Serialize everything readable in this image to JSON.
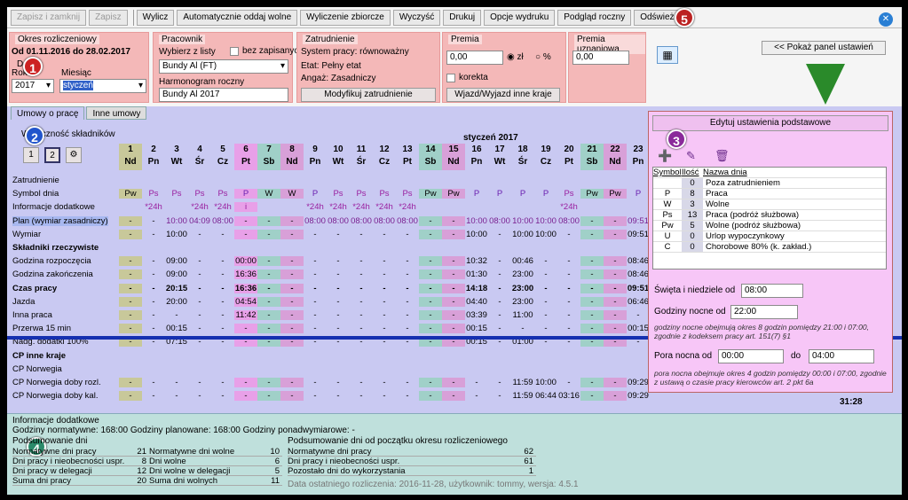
{
  "toolbar": {
    "save_close": "Zapisz i zamknij",
    "save": "Zapisz",
    "calc": "Wylicz",
    "auto": "Automatycznie oddaj wolne",
    "calc_all": "Wyliczenie zbiorcze",
    "clear": "Wyczyść",
    "print": "Drukuj",
    "print_opts": "Opcje wydruku",
    "preview": "Podgląd roczny",
    "refresh": "Odśwież"
  },
  "badges": [
    "1",
    "2",
    "3",
    "4",
    "5"
  ],
  "period": {
    "title": "Okres rozliczeniowy",
    "range": "Od  01.11.2016  do  28.02.2017",
    "data_label": "Da",
    "year_label": "Rok",
    "year": "2017",
    "month_label": "Miesiąc",
    "month": "styczeń"
  },
  "employee": {
    "title": "Pracownik",
    "choose_label": "Wybierz z listy",
    "unsaved_label": "bez zapisanych",
    "name": "Bundy Al (FT)",
    "harm_label": "Harmonogram roczny",
    "harm": "Bundy Al 2017"
  },
  "employment": {
    "title": "Zatrudnienie",
    "system": "System pracy: równoważny",
    "etat": "Etat: Pełny etat",
    "angaz": "Angaż: Zasadniczy",
    "modify": "Modyfikuj zatrudnienie"
  },
  "premia": {
    "title": "Premia",
    "value": "0,00",
    "pln": "zł",
    "pct": "%",
    "korekta": "korekta",
    "trip": "Wjazd/Wyjazd inne kraje"
  },
  "premia_uzn": {
    "title": "Premia uznaniowa",
    "value": "0,00"
  },
  "show_panel": "<< Pokaż panel ustawień",
  "tabs": [
    "Umowy o pracę",
    "Inne umowy"
  ],
  "grid": {
    "month_title": "styczeń 2017",
    "view_label": "Widoczność składników",
    "view_btns": [
      "1",
      "2"
    ],
    "days": [
      {
        "n": "1",
        "w": "Nd",
        "c": "#c8c89a"
      },
      {
        "n": "2",
        "w": "Pn",
        "c": ""
      },
      {
        "n": "3",
        "w": "Wt",
        "c": ""
      },
      {
        "n": "4",
        "w": "Śr",
        "c": ""
      },
      {
        "n": "5",
        "w": "Cz",
        "c": ""
      },
      {
        "n": "6",
        "w": "Pt",
        "c": "#e8a0e8"
      },
      {
        "n": "7",
        "w": "Sb",
        "c": "#a0d0c8"
      },
      {
        "n": "8",
        "w": "Nd",
        "c": "#d8a0d8"
      },
      {
        "n": "9",
        "w": "Pn",
        "c": ""
      },
      {
        "n": "10",
        "w": "Wt",
        "c": ""
      },
      {
        "n": "11",
        "w": "Śr",
        "c": ""
      },
      {
        "n": "12",
        "w": "Cz",
        "c": ""
      },
      {
        "n": "13",
        "w": "Pt",
        "c": ""
      },
      {
        "n": "14",
        "w": "Sb",
        "c": "#a0d0c8"
      },
      {
        "n": "15",
        "w": "Nd",
        "c": "#d8a0d8"
      },
      {
        "n": "16",
        "w": "Pn",
        "c": ""
      },
      {
        "n": "17",
        "w": "Wt",
        "c": ""
      },
      {
        "n": "18",
        "w": "Śr",
        "c": ""
      },
      {
        "n": "19",
        "w": "Cz",
        "c": ""
      },
      {
        "n": "20",
        "w": "Pt",
        "c": ""
      },
      {
        "n": "21",
        "w": "Sb",
        "c": "#a0d0c8"
      },
      {
        "n": "22",
        "w": "Nd",
        "c": "#d8a0d8"
      },
      {
        "n": "23",
        "w": "Pn",
        "c": ""
      }
    ],
    "rows": [
      {
        "label": "Zatrudnienie",
        "bold": false,
        "cells": [
          "",
          "",
          "",
          "",
          "",
          "",
          "",
          "",
          "",
          "",
          "",
          "",
          "",
          "",
          "",
          "",
          "",
          "",
          "",
          "",
          "",
          "",
          ""
        ]
      },
      {
        "label": "Symbol dnia",
        "bold": false,
        "cells": [
          "Pw",
          "Ps",
          "Ps",
          "Ps",
          "Ps",
          "P",
          "W",
          "W",
          "P",
          "Ps",
          "Ps",
          "Ps",
          "Ps",
          "Pw",
          "Pw",
          "P",
          "P",
          "P",
          "P",
          "Ps",
          "Pw",
          "Pw",
          "P"
        ]
      },
      {
        "label": "Informacje dodatkowe",
        "bold": false,
        "cells": [
          "",
          "*24h",
          "",
          "*24h",
          "*24h",
          "i",
          "",
          "",
          "*24h",
          "*24h",
          "*24h",
          "*24h",
          "*24h",
          "",
          "",
          "",
          "",
          "",
          "",
          "*24h",
          "",
          "",
          ""
        ]
      },
      {
        "label": "Plan (wymiar zasadniczy)",
        "bold": false,
        "cells": [
          "-",
          "-",
          "10:00",
          "04:09",
          "08:00",
          "-",
          "-",
          "-",
          "08:00",
          "08:00",
          "08:00",
          "08:00",
          "08:00",
          "-",
          "-",
          "10:00",
          "08:00",
          "10:00",
          "10:00",
          "08:00",
          "-",
          "-",
          "09:51"
        ]
      },
      {
        "label": "Wymiar",
        "bold": false,
        "cells": [
          "-",
          "-",
          "10:00",
          "-",
          "-",
          "-",
          "-",
          "-",
          "-",
          "-",
          "-",
          "-",
          "-",
          "-",
          "-",
          "10:00",
          "-",
          "10:00",
          "10:00",
          "-",
          "-",
          "-",
          "09:51"
        ]
      },
      {
        "label": "Składniki rzeczywiste",
        "bold": true,
        "cells": [
          "",
          "",
          "",
          "",
          "",
          "",
          "",
          "",
          "",
          "",
          "",
          "",
          "",
          "",
          "",
          "",
          "",
          "",
          "",
          "",
          "",
          "",
          ""
        ]
      },
      {
        "label": "Godzina rozpoczęcia",
        "bold": false,
        "cells": [
          "-",
          "-",
          "09:00",
          "-",
          "-",
          "00:00",
          "-",
          "-",
          "-",
          "-",
          "-",
          "-",
          "-",
          "-",
          "-",
          "10:32",
          "-",
          "00:46",
          "-",
          "-",
          "-",
          "-",
          "08:46"
        ]
      },
      {
        "label": "Godzina zakończenia",
        "bold": false,
        "cells": [
          "-",
          "-",
          "09:00",
          "-",
          "-",
          "16:36",
          "-",
          "-",
          "-",
          "-",
          "-",
          "-",
          "-",
          "-",
          "-",
          "01:30",
          "-",
          "23:00",
          "-",
          "-",
          "-",
          "-",
          "08:46"
        ]
      },
      {
        "label": "Czas pracy",
        "bold": true,
        "cells": [
          "-",
          "-",
          "20:15",
          "-",
          "-",
          "16:36",
          "-",
          "-",
          "-",
          "-",
          "-",
          "-",
          "-",
          "-",
          "-",
          "14:18",
          "-",
          "23:00",
          "-",
          "-",
          "-",
          "-",
          "09:51"
        ]
      },
      {
        "label": "Jazda",
        "bold": false,
        "cells": [
          "-",
          "-",
          "20:00",
          "-",
          "-",
          "04:54",
          "-",
          "-",
          "-",
          "-",
          "-",
          "-",
          "-",
          "-",
          "-",
          "04:40",
          "-",
          "23:00",
          "-",
          "-",
          "-",
          "-",
          "06:46"
        ]
      },
      {
        "label": "Inna praca",
        "bold": false,
        "cells": [
          "-",
          "-",
          "-",
          "-",
          "-",
          "11:42",
          "-",
          "-",
          "-",
          "-",
          "-",
          "-",
          "-",
          "-",
          "-",
          "03:39",
          "-",
          "11:00",
          "-",
          "-",
          "-",
          "-",
          "-"
        ]
      },
      {
        "label": "Przerwa 15 min",
        "bold": false,
        "cells": [
          "-",
          "-",
          "00:15",
          "-",
          "-",
          "-",
          "-",
          "-",
          "-",
          "-",
          "-",
          "-",
          "-",
          "-",
          "-",
          "00:15",
          "-",
          "-",
          "-",
          "-",
          "-",
          "-",
          "00:15"
        ]
      },
      {
        "label": "Nadg. dodatki 100%",
        "bold": false,
        "cells": [
          "-",
          "-",
          "07:15",
          "-",
          "-",
          "-",
          "-",
          "-",
          "-",
          "-",
          "-",
          "-",
          "-",
          "-",
          "-",
          "00:15",
          "-",
          "01:00",
          "-",
          "-",
          "-",
          "-",
          "-"
        ]
      },
      {
        "label": "CP inne kraje",
        "bold": true,
        "cells": [
          "",
          "",
          "",
          "",
          "",
          "",
          "",
          "",
          "",
          "",
          "",
          "",
          "",
          "",
          "",
          "",
          "",
          "",
          "",
          "",
          "",
          "",
          ""
        ]
      },
      {
        "label": "CP Norwegia",
        "bold": false,
        "cells": [
          "",
          "",
          "",
          "",
          "",
          "",
          "",
          "",
          "",
          "",
          "",
          "",
          "",
          "",
          "",
          "",
          "",
          "",
          "",
          "",
          "",
          "",
          ""
        ]
      },
      {
        "label": "CP Norwegia doby rozl.",
        "bold": false,
        "cells": [
          "-",
          "-",
          "-",
          "-",
          "-",
          "-",
          "-",
          "-",
          "-",
          "-",
          "-",
          "-",
          "-",
          "-",
          "-",
          "-",
          "-",
          "11:59",
          "10:00",
          "-",
          "-",
          "-",
          "09:29"
        ]
      },
      {
        "label": "CP Norwegia doby kal.",
        "bold": false,
        "cells": [
          "-",
          "-",
          "-",
          "-",
          "-",
          "-",
          "-",
          "-",
          "-",
          "-",
          "-",
          "-",
          "-",
          "-",
          "-",
          "-",
          "-",
          "11:59",
          "06:44",
          "03:16",
          "-",
          "-",
          "09:29"
        ]
      }
    ],
    "right_edge": "31:28"
  },
  "panel": {
    "title": "Edytuj ustawienia podstawowe",
    "cols": [
      "Symbol",
      "Ilość",
      "Nazwa dnia"
    ],
    "symbols": [
      {
        "s": "",
        "q": "0",
        "n": "Poza zatrudnieniem"
      },
      {
        "s": "P",
        "q": "8",
        "n": "Praca"
      },
      {
        "s": "W",
        "q": "3",
        "n": "Wolne"
      },
      {
        "s": "Ps",
        "q": "13",
        "n": "Praca (podróż służbowa)"
      },
      {
        "s": "Pw",
        "q": "5",
        "n": "Wolne (podróż służbowa)"
      },
      {
        "s": "U",
        "q": "0",
        "n": "Urlop wypoczynkowy"
      },
      {
        "s": "C",
        "q": "0",
        "n": "Chorobowe 80% (k. zakład.)"
      }
    ],
    "holidays_label": "Święta i niedziele od",
    "holidays": "08:00",
    "night_label": "Godziny nocne od",
    "night": "22:00",
    "night_note": "godziny nocne obejmują okres 8 godzin pomiędzy 21:00 i 07:00, zgodnie z kodeksem pracy art. 151(7) §1",
    "pora_label": "Pora nocna od",
    "pora_from": "00:00",
    "pora_do": "do",
    "pora_to": "04:00",
    "pora_note": "pora nocna obejmuje okres 4 godzin pomiędzy 00:00 i 07:00, zgodnie z ustawą o czasie pracy kierowców art. 2 pkt 6a"
  },
  "info": {
    "title": "Informacje dodatkowe",
    "line": "Godziny normatywne: 168:00   Godziny planowane: 168:00    Godziny ponadwymiarowe: -",
    "summary_title": "Podsumowanie dni",
    "period_title": "Podsumowanie dni od początku okresu rozliczeniowego",
    "left": [
      [
        "Normatywne dni pracy",
        "21"
      ],
      [
        "Dni pracy i nieobecności uspr.",
        "8"
      ],
      [
        "Dni pracy w delegacji",
        "12"
      ],
      [
        "Suma dni pracy",
        "20"
      ]
    ],
    "mid": [
      [
        "Normatywne dni wolne",
        "10"
      ],
      [
        "Dni wolne",
        "6"
      ],
      [
        "Dni wolne w delegacji",
        "5"
      ],
      [
        "Suma dni wolnych",
        "11"
      ]
    ],
    "right": [
      [
        "Normatywne dni pracy",
        "62"
      ],
      [
        "Dni pracy i nieobecności uspr.",
        "61"
      ],
      [
        "Pozostało dni do wykorzystania",
        "1"
      ]
    ],
    "footer": "Data ostatniego rozliczenia: 2016-11-28, użytkownik: tommy, wersja: 4.5.1"
  }
}
